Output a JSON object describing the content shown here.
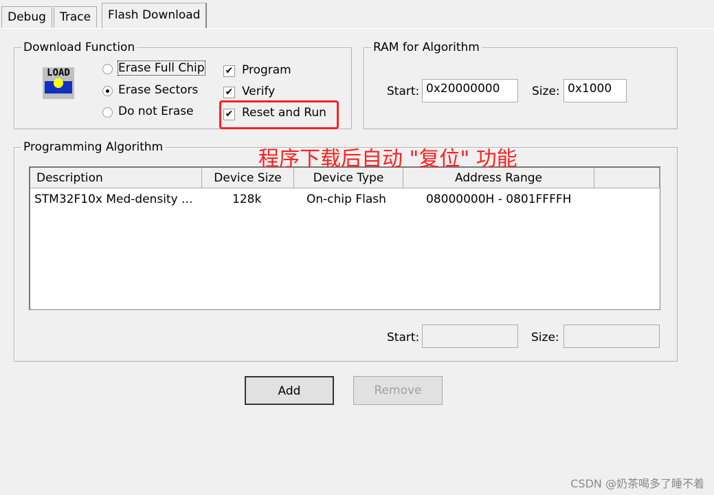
{
  "tabs": [
    {
      "label": "Debug"
    },
    {
      "label": "Trace"
    },
    {
      "label": "Flash Download"
    }
  ],
  "download_function": {
    "title": "Download Function",
    "icon": "load-icon",
    "icon_text": "LOAD",
    "erase_options": [
      {
        "label": "Erase Full Chip",
        "selected": false
      },
      {
        "label": "Erase Sectors",
        "selected": true
      },
      {
        "label": "Do not Erase",
        "selected": false
      }
    ],
    "checks": [
      {
        "label": "Program",
        "checked": true
      },
      {
        "label": "Verify",
        "checked": true
      },
      {
        "label": "Reset and Run",
        "checked": true
      }
    ]
  },
  "ram": {
    "title": "RAM for Algorithm",
    "start_label": "Start:",
    "start": "0x20000000",
    "size_label": "Size:",
    "size": "0x1000"
  },
  "algorithm": {
    "title": "Programming Algorithm",
    "columns": [
      "Description",
      "Device Size",
      "Device Type",
      "Address Range"
    ],
    "rows": [
      [
        "STM32F10x Med-density ...",
        "128k",
        "On-chip Flash",
        "08000000H - 0801FFFFH"
      ]
    ],
    "start_label": "Start:",
    "start": "",
    "size_label": "Size:",
    "size": ""
  },
  "annotation": "程序下载后自动 \"复位\" 功能",
  "highlight_color": "#ff2020",
  "buttons": {
    "add": "Add",
    "remove": "Remove"
  },
  "watermark": "CSDN @奶茶喝多了睡不着"
}
